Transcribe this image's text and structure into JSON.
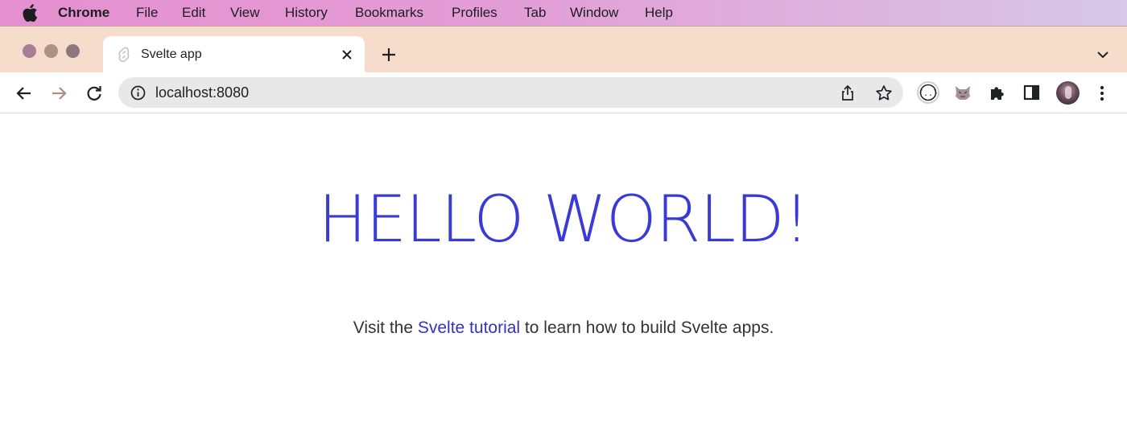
{
  "menubar": {
    "app_name": "Chrome",
    "items": [
      "File",
      "Edit",
      "View",
      "History",
      "Bookmarks",
      "Profiles",
      "Tab",
      "Window",
      "Help"
    ]
  },
  "tabs": [
    {
      "title": "Svelte app",
      "favicon": "svelte-icon",
      "active": true
    }
  ],
  "toolbar": {
    "url": "localhost:8080",
    "icons": [
      "back-icon",
      "forward-icon",
      "reload-icon",
      "info-icon",
      "share-icon",
      "star-icon",
      "extension-api-icon",
      "extension-fox-icon",
      "puzzle-icon",
      "side-panel-icon",
      "avatar",
      "more-icon"
    ]
  },
  "page": {
    "heading": "HELLO WORLD!",
    "paragraph": {
      "before": "Visit the ",
      "link_text": "Svelte tutorial",
      "after": " to learn how to build Svelte apps."
    }
  },
  "colors": {
    "heading": "#3a3ad4",
    "link": "#3333bb",
    "tabstrip": "#f6dcca",
    "traffic_lights": [
      "#a67e96",
      "#b08f8a",
      "#8e7680"
    ]
  }
}
